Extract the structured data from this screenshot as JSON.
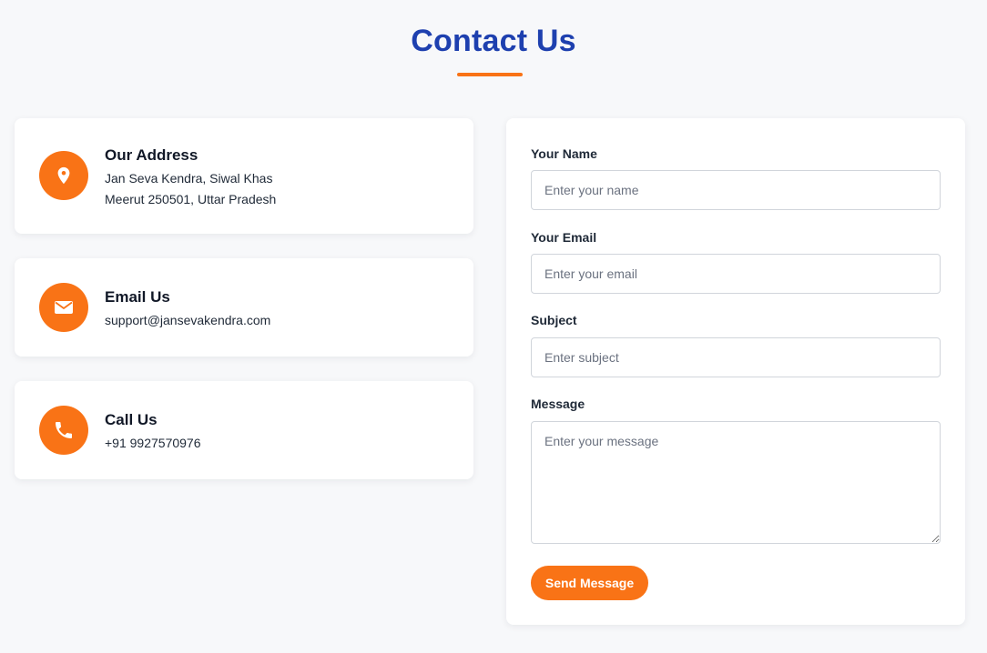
{
  "page": {
    "title": "Contact Us"
  },
  "colors": {
    "accent": "#f97316",
    "heading": "#1e40af",
    "background": "#f7f8fa",
    "card": "#ffffff"
  },
  "contact_info": [
    {
      "icon": "map-pin-icon",
      "title": "Our Address",
      "lines": [
        "Jan Seva Kendra, Siwal Khas",
        "Meerut 250501, Uttar Pradesh"
      ]
    },
    {
      "icon": "envelope-icon",
      "title": "Email Us",
      "lines": [
        "support@jansevakendra.com"
      ]
    },
    {
      "icon": "phone-icon",
      "title": "Call Us",
      "lines": [
        "+91 9927570976"
      ]
    }
  ],
  "form": {
    "name_label": "Your Name",
    "name_placeholder": "Enter your name",
    "name_value": "",
    "email_label": "Your Email",
    "email_placeholder": "Enter your email",
    "email_value": "",
    "subject_label": "Subject",
    "subject_placeholder": "Enter subject",
    "subject_value": "",
    "message_label": "Message",
    "message_placeholder": "Enter your message",
    "message_value": "",
    "submit_label": "Send Message"
  }
}
